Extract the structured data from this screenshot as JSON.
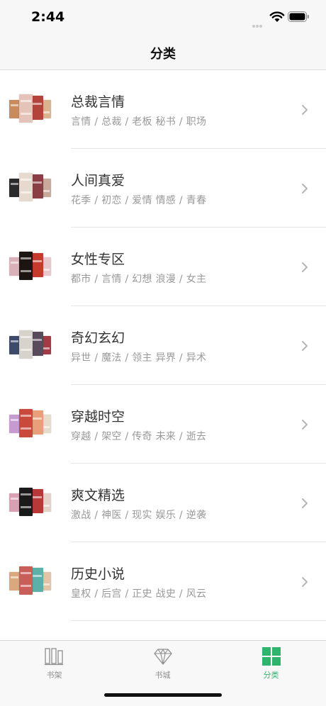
{
  "status": {
    "time": "2:44"
  },
  "nav": {
    "title": "分类"
  },
  "categories": [
    {
      "title": "总裁言情",
      "tags": "言情 / 总裁 / 老板  秘书 / 职场",
      "cover_colors": [
        "#c98a5c",
        "#e6c3b8",
        "#b3443c",
        "#d9b48f"
      ]
    },
    {
      "title": "人间真爱",
      "tags": "花季 / 初恋 / 爱情  情感 / 青春",
      "cover_colors": [
        "#2b2b2b",
        "#e8d9cf",
        "#8a3f45",
        "#c8a99b"
      ]
    },
    {
      "title": "女性专区",
      "tags": "都市 / 言情 / 幻想  浪漫 / 女主",
      "cover_colors": [
        "#d8b2b8",
        "#1c1410",
        "#c53a2c",
        "#e7c6cc"
      ]
    },
    {
      "title": "奇幻玄幻",
      "tags": "异世 / 魔法 / 领主  异界 / 异术",
      "cover_colors": [
        "#3d4a6a",
        "#d8d2cc",
        "#5a4a5c",
        "#a43a45"
      ]
    },
    {
      "title": "穿越时空",
      "tags": "穿越 / 架空 / 传奇  未来 / 逝去",
      "cover_colors": [
        "#c79bd0",
        "#c94a3a",
        "#e9a07a",
        "#e7dccb"
      ]
    },
    {
      "title": "爽文精选",
      "tags": "激战 / 神医 / 现实  娱乐 / 逆袭",
      "cover_colors": [
        "#d8a0b2",
        "#1a1a1a",
        "#b83838",
        "#e4d2c8"
      ]
    },
    {
      "title": "历史小说",
      "tags": "皇权 / 后宫 / 正史  战史 / 风云",
      "cover_colors": [
        "#d9a87c",
        "#c95d5a",
        "#5bb0a8",
        "#e3c4a8"
      ]
    }
  ],
  "tabbar": {
    "tabs": [
      {
        "label": "书架",
        "icon": "bookshelf-icon",
        "active": false
      },
      {
        "label": "书城",
        "icon": "diamond-icon",
        "active": false
      },
      {
        "label": "分类",
        "icon": "grid-icon",
        "active": true
      }
    ]
  },
  "colors": {
    "accent": "#2fb46d",
    "inactive": "#8e8e8e",
    "tags": "#999999"
  }
}
